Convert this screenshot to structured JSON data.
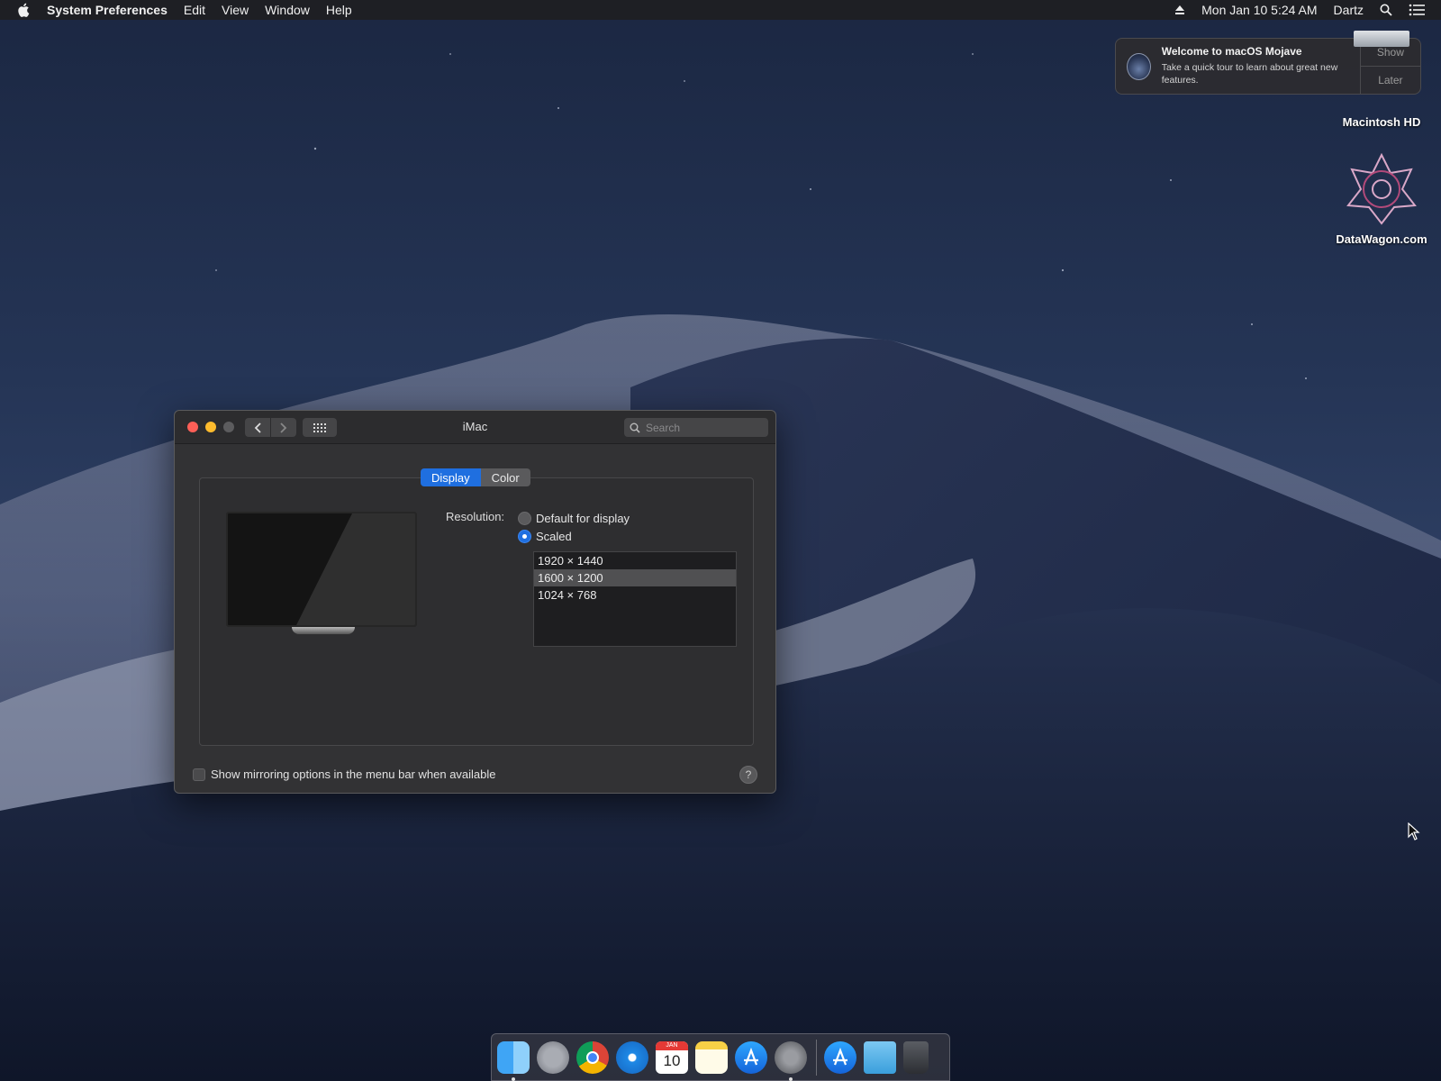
{
  "menubar": {
    "app": "System Preferences",
    "items": [
      "Edit",
      "View",
      "Window",
      "Help"
    ],
    "datetime": "Mon Jan 10  5:24 AM",
    "user": "Dartz"
  },
  "notification": {
    "title": "Welcome to macOS Mojave",
    "body": "Take a quick tour to learn about great new features.",
    "show": "Show",
    "later": "Later"
  },
  "desktop": {
    "hd_label": "Macintosh HD",
    "app_label": "DataWagon.com"
  },
  "window": {
    "title": "iMac",
    "search_placeholder": "Search",
    "tabs": [
      {
        "label": "Display",
        "active": true
      },
      {
        "label": "Color",
        "active": false
      }
    ],
    "resolution_label": "Resolution:",
    "radio_default": "Default for display",
    "radio_scaled": "Scaled",
    "resolutions": [
      "1920 × 1440",
      "1600 × 1200",
      "1024 × 768"
    ],
    "selected_resolution": "1600 × 1200",
    "mirror_label": "Show mirroring options in the menu bar when available",
    "help": "?"
  },
  "dock": {
    "calendar_day": "10",
    "calendar_month": "JAN"
  },
  "colors": {
    "accent": "#1f6fe0"
  }
}
